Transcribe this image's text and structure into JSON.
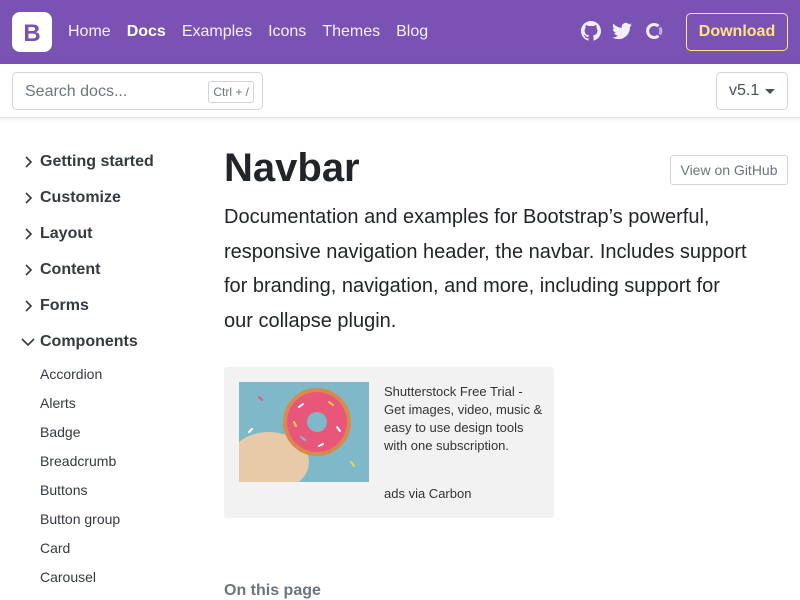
{
  "navbar": {
    "brand_letter": "B",
    "links": [
      {
        "label": "Home"
      },
      {
        "label": "Docs"
      },
      {
        "label": "Examples"
      },
      {
        "label": "Icons"
      },
      {
        "label": "Themes"
      },
      {
        "label": "Blog"
      }
    ],
    "active_link": "Docs",
    "social_icons": [
      "github-icon",
      "twitter-icon",
      "opencollective-icon"
    ],
    "download_label": "Download",
    "colors": {
      "background": "#7952b3",
      "download_accent": "#ffe484"
    }
  },
  "subnav": {
    "search_placeholder": "Search docs...",
    "search_shortcut": "Ctrl + /",
    "version": "v5.1"
  },
  "sidebar": {
    "groups": [
      {
        "label": "Getting started",
        "expanded": false
      },
      {
        "label": "Customize",
        "expanded": false
      },
      {
        "label": "Layout",
        "expanded": false
      },
      {
        "label": "Content",
        "expanded": false
      },
      {
        "label": "Forms",
        "expanded": false
      },
      {
        "label": "Components",
        "expanded": true
      }
    ],
    "component_items": [
      "Accordion",
      "Alerts",
      "Badge",
      "Breadcrumb",
      "Buttons",
      "Button group",
      "Card",
      "Carousel"
    ]
  },
  "main": {
    "title": "Navbar",
    "github_button": "View on GitHub",
    "lead_lines": [
      "Documentation and examples for Bootstrap’s powerful,",
      "responsive navigation header, the navbar. Includes support",
      "for branding, navigation, and more, including support for",
      "our collapse plugin."
    ],
    "ad": {
      "image_alt": "donut",
      "text": "Shutterstock Free Trial - Get images, video, music & easy to use design tools with one subscription.",
      "via": "ads via Carbon"
    },
    "on_this_page": "On this page"
  }
}
